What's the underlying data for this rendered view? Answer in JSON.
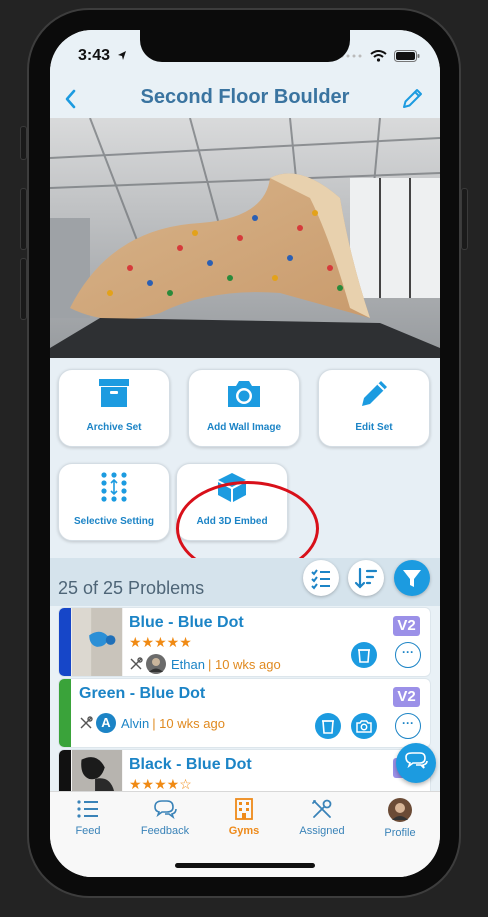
{
  "status": {
    "time": "3:43"
  },
  "nav": {
    "title": "Second Floor Boulder"
  },
  "actions": [
    {
      "label": "Archive Set",
      "icon": "archive-box-icon"
    },
    {
      "label": "Add Wall Image",
      "icon": "camera-icon"
    },
    {
      "label": "Edit Set",
      "icon": "pencil-icon"
    },
    {
      "label": "Selective Setting",
      "icon": "dot-grid-icon"
    },
    {
      "label": "Add 3D Embed",
      "icon": "cube-icon"
    }
  ],
  "list": {
    "count_text": "25 of 25 Problems",
    "problems": [
      {
        "name": "Blue - Blue Dot",
        "stars": "★★★★★",
        "setter": "Ethan",
        "age": "| 10 wks ago",
        "grade": "V2",
        "color": "#1646c8"
      },
      {
        "name": "Green - Blue Dot",
        "stars": "",
        "setter": "Alvin",
        "age": "| 10 wks ago",
        "grade": "V2",
        "color": "#3aa33a",
        "avatar_letter": "A"
      },
      {
        "name": "Black - Blue Dot",
        "stars": "★★★★☆",
        "setter": "",
        "age": "",
        "grade": "",
        "color": "#111111"
      }
    ]
  },
  "tabs": [
    {
      "label": "Feed",
      "icon": "list-icon"
    },
    {
      "label": "Feedback",
      "icon": "chat-bubbles-icon"
    },
    {
      "label": "Gyms",
      "icon": "building-icon",
      "active": true
    },
    {
      "label": "Assigned",
      "icon": "tools-icon"
    },
    {
      "label": "Profile",
      "icon": "avatar-icon"
    }
  ],
  "colors": {
    "accent": "#1c84c6",
    "active_tab": "#ee8a1a",
    "grade_badge": "#9b90e8",
    "highlight": "#d8101a"
  }
}
